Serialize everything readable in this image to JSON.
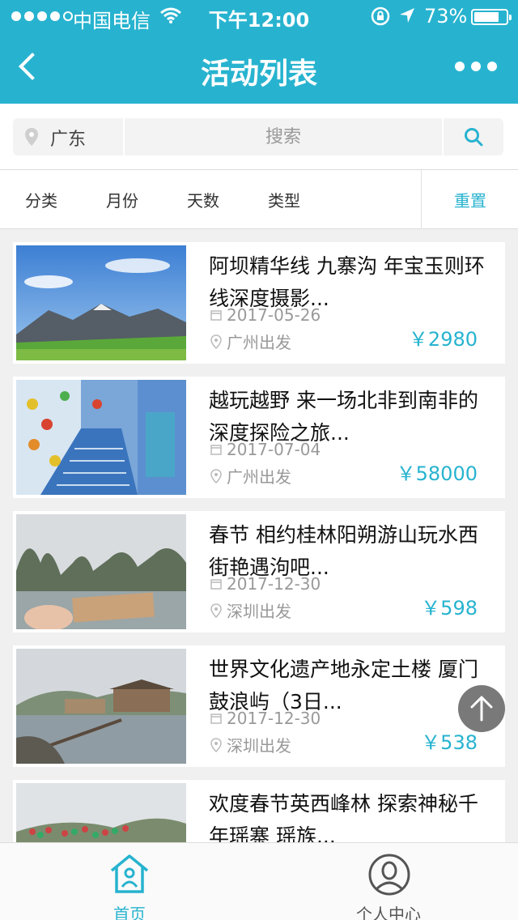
{
  "status_bar": {
    "carrier": "中国电信",
    "time": "下午12:00",
    "battery": "73%"
  },
  "header": {
    "title": "活动列表"
  },
  "search": {
    "location": "广东",
    "placeholder": "搜索"
  },
  "filters": {
    "items": [
      "分类",
      "月份",
      "天数",
      "类型"
    ],
    "reset_label": "重置"
  },
  "activities": [
    {
      "title": "阿坝精华线 九寨沟 年宝玉则环线深度摄影...",
      "date": "2017-05-26",
      "departure": "广州出发",
      "price": "￥2980"
    },
    {
      "title": "越玩越野 来一场北非到南非的深度探险之旅...",
      "date": "2017-07-04",
      "departure": "广州出发",
      "price": "￥58000"
    },
    {
      "title": "春节 相约桂林阳朔游山玩水西街艳遇泃吧...",
      "date": "2017-12-30",
      "departure": "深圳出发",
      "price": "￥598"
    },
    {
      "title": "世界文化遗产地永定土楼 厦门鼓浪屿（3日...",
      "date": "2017-12-30",
      "departure": "深圳出发",
      "price": "￥538"
    },
    {
      "title": "欢度春节英西峰林 探索神秘千年瑶寨 瑶族...",
      "date": "",
      "departure": "",
      "price": ""
    }
  ],
  "tabbar": {
    "home_label": "首页",
    "profile_label": "个人中心"
  },
  "colors": {
    "accent": "#27b3cf",
    "background": "#f0f0f0",
    "text_muted": "#999999"
  },
  "icons": {
    "back": "chevron-left-icon",
    "more": "more-dots-icon",
    "location": "pin-icon",
    "search": "search-icon",
    "date": "calendar-icon",
    "departure": "pin-icon",
    "to_top": "arrow-up-icon",
    "home": "home-icon",
    "profile": "user-icon"
  }
}
